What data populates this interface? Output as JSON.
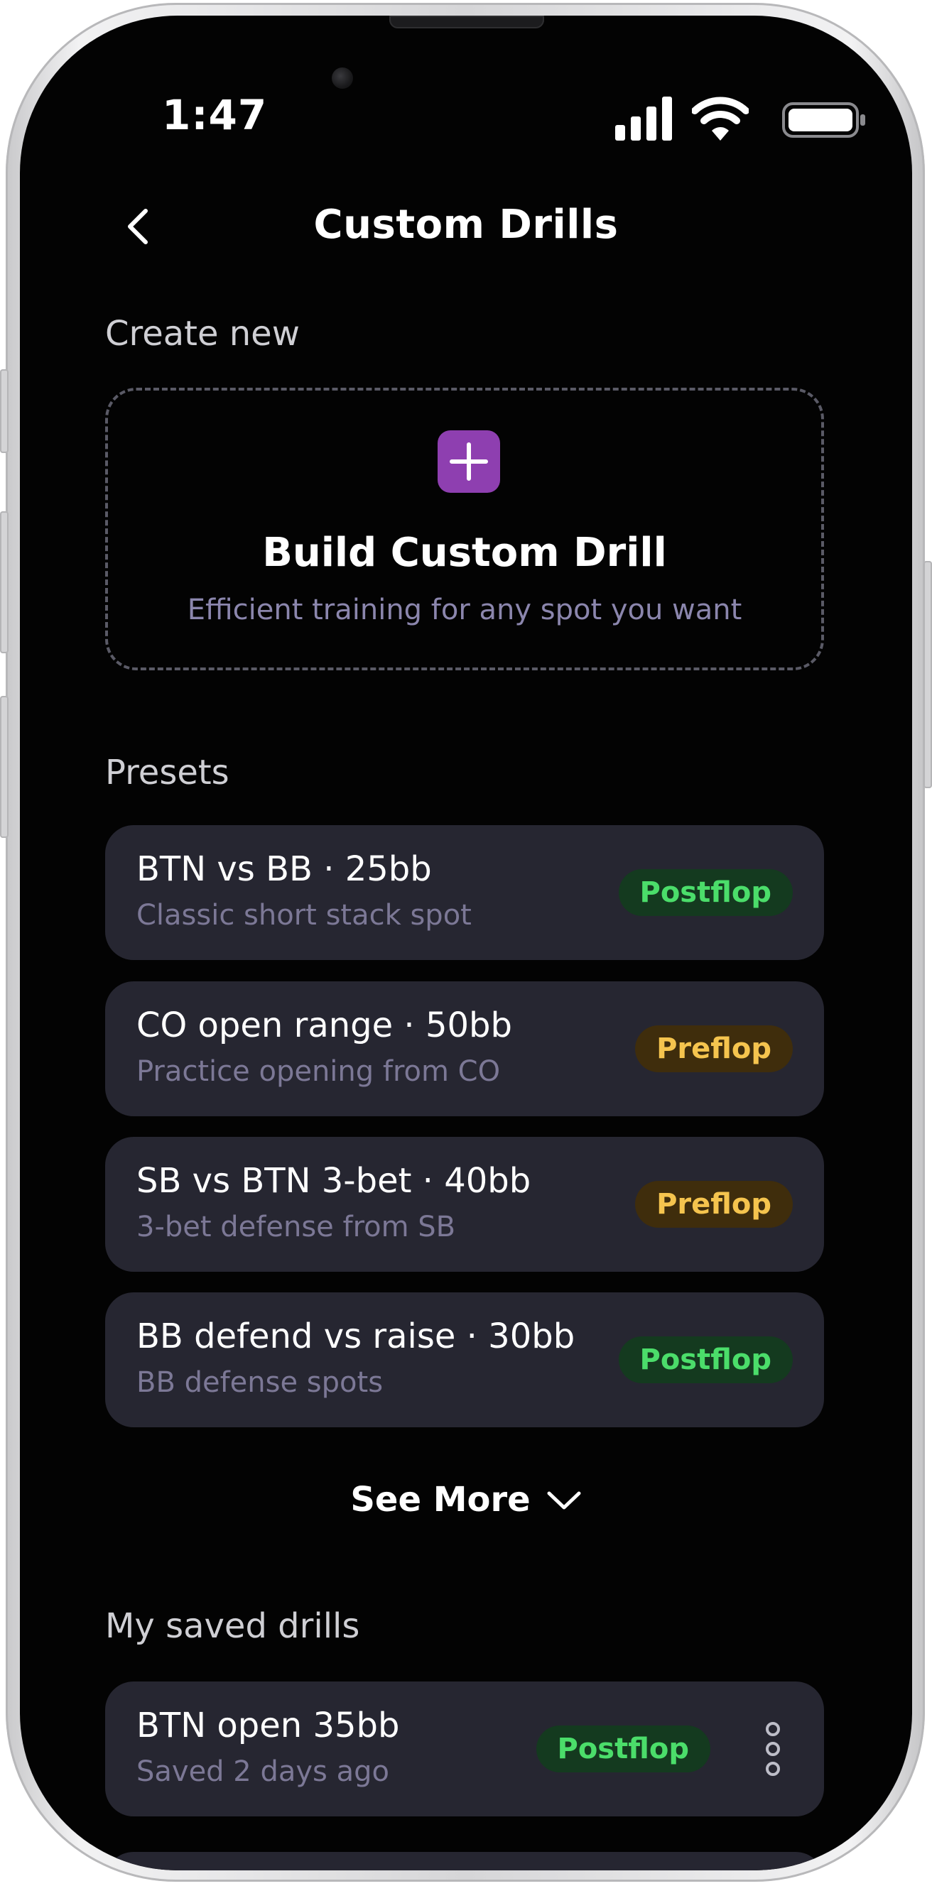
{
  "status_bar": {
    "time": "1:47"
  },
  "nav": {
    "title": "Custom Drills"
  },
  "create_section": {
    "label": "Create new",
    "card_title": "Build Custom Drill",
    "card_subtitle": "Efficient training for any spot you want",
    "accent_color": "#8e3fb0"
  },
  "presets": {
    "label": "Presets",
    "items": [
      {
        "title": "BTN vs BB · 25bb",
        "subtitle": "Classic short stack spot",
        "tag": "Postflop"
      },
      {
        "title": "CO open range · 50bb",
        "subtitle": "Practice opening from CO",
        "tag": "Preflop"
      },
      {
        "title": "SB vs BTN 3-bet · 40bb",
        "subtitle": "3-bet defense from SB",
        "tag": "Preflop"
      },
      {
        "title": "BB defend vs raise · 30bb",
        "subtitle": "BB defense spots",
        "tag": "Postflop"
      }
    ],
    "see_more_label": "See More"
  },
  "saved": {
    "label": "My saved drills",
    "items": [
      {
        "title": "BTN open 35bb",
        "subtitle": "Saved 2 days ago",
        "tag": "Postflop"
      }
    ]
  },
  "colors": {
    "background": "#030303",
    "card": "#262631",
    "postflop_text": "#4bdd6a",
    "postflop_bg": "#143a1f",
    "preflop_text": "#f5c44e",
    "preflop_bg": "#3f2d0c",
    "muted_text": "#7c7896"
  },
  "icons": {
    "back": "chevron-left-icon",
    "add": "plus-icon",
    "expand": "chevron-down-icon",
    "more": "more-vertical-icon",
    "signal": "cellular-signal-icon",
    "wifi": "wifi-icon",
    "battery": "battery-icon"
  }
}
